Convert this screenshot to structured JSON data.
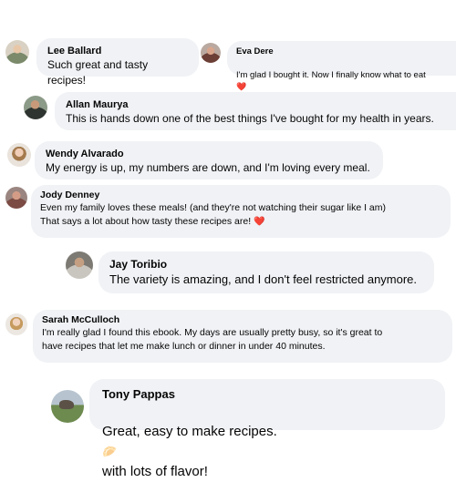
{
  "comments": [
    {
      "name": "Lee Ballard",
      "text": "Such great and tasty recipes!"
    },
    {
      "name": "Eva Dere",
      "text": "I'm glad I bought it. Now I finally know what to eat",
      "emoji": "❤️"
    },
    {
      "name": "Allan Maurya",
      "text": "This is hands down one of the best things I've bought for my health in years."
    },
    {
      "name": "Wendy Alvarado",
      "text": "My energy is up, my numbers are down, and I'm loving every meal."
    },
    {
      "name": "Jody Denney",
      "text": "Even my family loves these meals! (and they're not watching their sugar like I am)\nThat says a lot about how tasty these recipes are!",
      "emoji": "❤️"
    },
    {
      "name": "Jay Toribio",
      "text": "The variety is amazing, and I don't feel restricted anymore."
    },
    {
      "name": "Sarah McCulloch",
      "text": "I'm really glad I found this ebook. My days are usually pretty busy, so it's great to\nhave recipes that let me make lunch or dinner in under 40 minutes."
    },
    {
      "name": "Tony Pappas",
      "text_before": "Great, easy to make recipes.",
      "emoji": "🥟",
      "text_after": "with lots of flavor!"
    }
  ]
}
